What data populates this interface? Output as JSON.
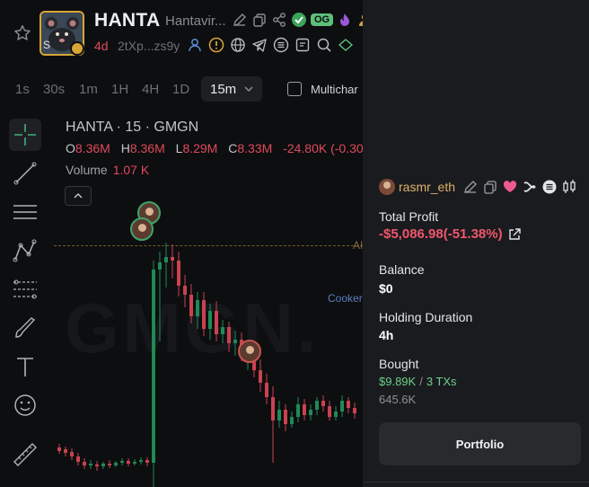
{
  "header": {
    "ticker": "HANTA",
    "token_name": "Hantavir...",
    "og_badge": "OG",
    "age": "4d",
    "address": "2tXp...zs9y",
    "icons_row1": [
      "edit-icon",
      "copy-icon",
      "share-icon",
      "verified-icon",
      "og-badge",
      "fire-icon",
      "user-icon"
    ],
    "icons_row2": [
      "user-icon",
      "warning-icon",
      "globe-icon",
      "telegram-icon",
      "list-icon",
      "note-icon",
      "search-icon",
      "pump-icon"
    ]
  },
  "timeframes": {
    "options": [
      "1s",
      "30s",
      "1m",
      "1H",
      "4H",
      "1D"
    ],
    "selected": "15m",
    "multichart_label": "Multichar"
  },
  "toolbar": {
    "tools": [
      "crosshair-icon",
      "trend-line-icon",
      "horizontal-lines-icon",
      "pattern-icon",
      "fib-icon",
      "brush-icon",
      "text-icon",
      "emoji-icon",
      "ruler-icon"
    ]
  },
  "chart": {
    "title": "HANTA · 15 · GMGN",
    "ohlc": {
      "o_label": "O",
      "o": "8.36M",
      "h_label": "H",
      "h": "8.36M",
      "l_label": "L",
      "l": "8.29M",
      "c_label": "C",
      "c": "8.33M",
      "change": "-24.80K (-0.30"
    },
    "volume_label": "Volume",
    "volume_value": "1.07 K",
    "watermark": "GMGN.",
    "ath_label": "AI",
    "cooker_label": "Cooker",
    "colors": {
      "up": "#1f8a55",
      "down": "#c9424f",
      "ath": "#7a5a2a"
    }
  },
  "panel": {
    "trader_name": "rasmr_eth",
    "trader_icons": [
      "edit-icon",
      "copy-icon",
      "heart-icon",
      "x-icon",
      "list-icon",
      "candles-icon"
    ],
    "total_profit_label": "Total Profit",
    "total_profit_value": "-$5,086.98(-51.38%)",
    "balance_label": "Balance",
    "balance_value": "$0",
    "holding_label": "Holding Duration",
    "holding_value": "4h",
    "bought_label": "Bought",
    "bought_usd": "$9.89K",
    "bought_sep": "/",
    "bought_txs": "3 TXs",
    "bought_amount": "645.6K",
    "portfolio_button": "Portfolio"
  }
}
